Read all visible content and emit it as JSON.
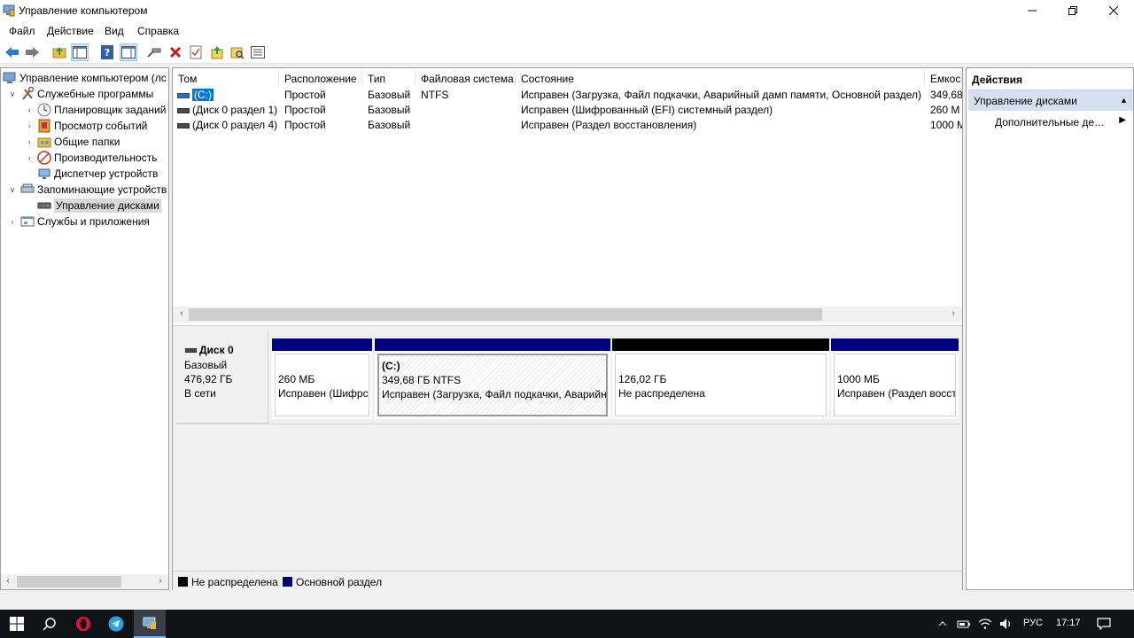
{
  "window": {
    "title": "Управление компьютером"
  },
  "menu": [
    "Файл",
    "Действие",
    "Вид",
    "Справка"
  ],
  "tree": {
    "items": [
      {
        "label": "Управление компьютером (лс"
      },
      {
        "label": "Служебные программы"
      },
      {
        "label": "Планировщик заданий"
      },
      {
        "label": "Просмотр событий"
      },
      {
        "label": "Общие папки"
      },
      {
        "label": "Производительность"
      },
      {
        "label": "Диспетчер устройств"
      },
      {
        "label": "Запоминающие устройств"
      },
      {
        "label": "Управление дисками"
      },
      {
        "label": "Службы и приложения"
      }
    ]
  },
  "volumes": {
    "columns": [
      "Том",
      "Расположение",
      "Тип",
      "Файловая система",
      "Состояние",
      "Емкос"
    ],
    "rows": [
      {
        "name": "(C:)",
        "layout": "Простой",
        "type": "Базовый",
        "fs": "NTFS",
        "status": "Исправен (Загрузка, Файл подкачки, Аварийный дамп памяти, Основной раздел)",
        "capacity": "349,68"
      },
      {
        "name": "(Диск 0 раздел 1)",
        "layout": "Простой",
        "type": "Базовый",
        "fs": "",
        "status": "Исправен (Шифрованный (EFI) системный раздел)",
        "capacity": "260 М"
      },
      {
        "name": "(Диск 0 раздел 4)",
        "layout": "Простой",
        "type": "Базовый",
        "fs": "",
        "status": "Исправен (Раздел восстановления)",
        "capacity": "1000 М"
      }
    ]
  },
  "disk": {
    "name": "Диск 0",
    "type": "Базовый",
    "size": "476,92 ГБ",
    "state": "В сети",
    "partitions": [
      {
        "label": "",
        "size": "260 МБ",
        "status": "Исправен (Шифрс"
      },
      {
        "label": "(C:)",
        "size": "349,68 ГБ NTFS",
        "status": "Исправен (Загрузка, Файл подкачки, Аварийн"
      },
      {
        "label": "",
        "size": "126,02 ГБ",
        "status": "Не распределена"
      },
      {
        "label": "",
        "size": "1000 МБ",
        "status": "Исправен (Раздел восст"
      }
    ]
  },
  "legend": {
    "unallocated": "Не распределена",
    "primary": "Основной раздел"
  },
  "colors": {
    "primary": "#000080",
    "unallocated": "#000000",
    "selection": "#0078d7",
    "action_section": "#d4dff0"
  },
  "actions": {
    "title": "Действия",
    "section": "Управление дисками",
    "more": "Дополнительные действия"
  },
  "taskbar": {
    "lang": "РУС",
    "time": "17:17"
  },
  "icons": [
    "back-icon",
    "forward-icon",
    "up-folder-icon",
    "show-hide-tree-icon",
    "help-icon",
    "properties-icon",
    "connect-icon",
    "delete-icon",
    "check-icon",
    "folder-up-icon",
    "search-folder-icon",
    "list-icon"
  ]
}
